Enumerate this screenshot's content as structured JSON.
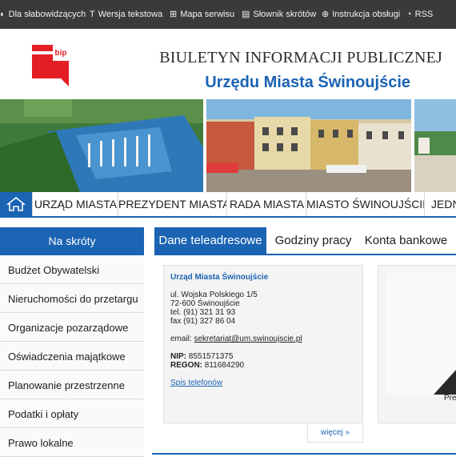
{
  "topbar": {
    "items": [
      {
        "label": "Dla słabowidzących",
        "icon": "eye-icon"
      },
      {
        "label": "Wersja tekstowa",
        "icon": "text-version-icon"
      },
      {
        "label": "Mapa serwisu",
        "icon": "sitemap-icon"
      },
      {
        "label": "Słownik skrótów",
        "icon": "book-icon"
      },
      {
        "label": "Instrukcja obsługi",
        "icon": "help-icon"
      },
      {
        "label": "RSS",
        "icon": "rss-icon"
      }
    ]
  },
  "header": {
    "logo_text": "bip",
    "title_line1": "BIULETYN INFORMACJI PUBLICZNEJ",
    "title_line2": "Urzędu Miasta Świnoujście"
  },
  "nav": {
    "items": [
      "URZĄD MIASTA",
      "PREZYDENT MIASTA",
      "RADA MIASTA",
      "MIASTO ŚWINOUJŚCIE",
      "JEDN"
    ]
  },
  "sidebar": {
    "heading": "Na skróty",
    "items": [
      "Budżet Obywatelski",
      "Nieruchomości do przetargu",
      "Organizacje pozarządowe",
      "Oświadczenia majątkowe",
      "Planowanie przestrzenne",
      "Podatki i opłaty",
      "Prawo lokalne"
    ]
  },
  "tabs": {
    "items": [
      "Dane teleadresowe",
      "Godziny pracy",
      "Konta bankowe"
    ],
    "active": 0
  },
  "contact": {
    "name": "Urząd Miasta Świnoujście",
    "street": "ul. Wojska Polskiego 1/5",
    "city": "72-600 Świnoujście",
    "tel": "tel. (91) 321 31 93",
    "fax": "fax  (91) 327 86 04",
    "email_label": "email:",
    "email": "sekretariat@um.swinoujscie.pl",
    "nip_label": "NIP:",
    "nip": "8551571375",
    "regon_label": "REGON:",
    "regon": "811684290",
    "phones_link": "Spis telefonów",
    "more": "więcej   »"
  },
  "president_box": {
    "caption": "Prez"
  },
  "colors": {
    "accent": "#1b63b3",
    "topbar": "#3a3a3a",
    "logo_red": "#e31e24"
  }
}
